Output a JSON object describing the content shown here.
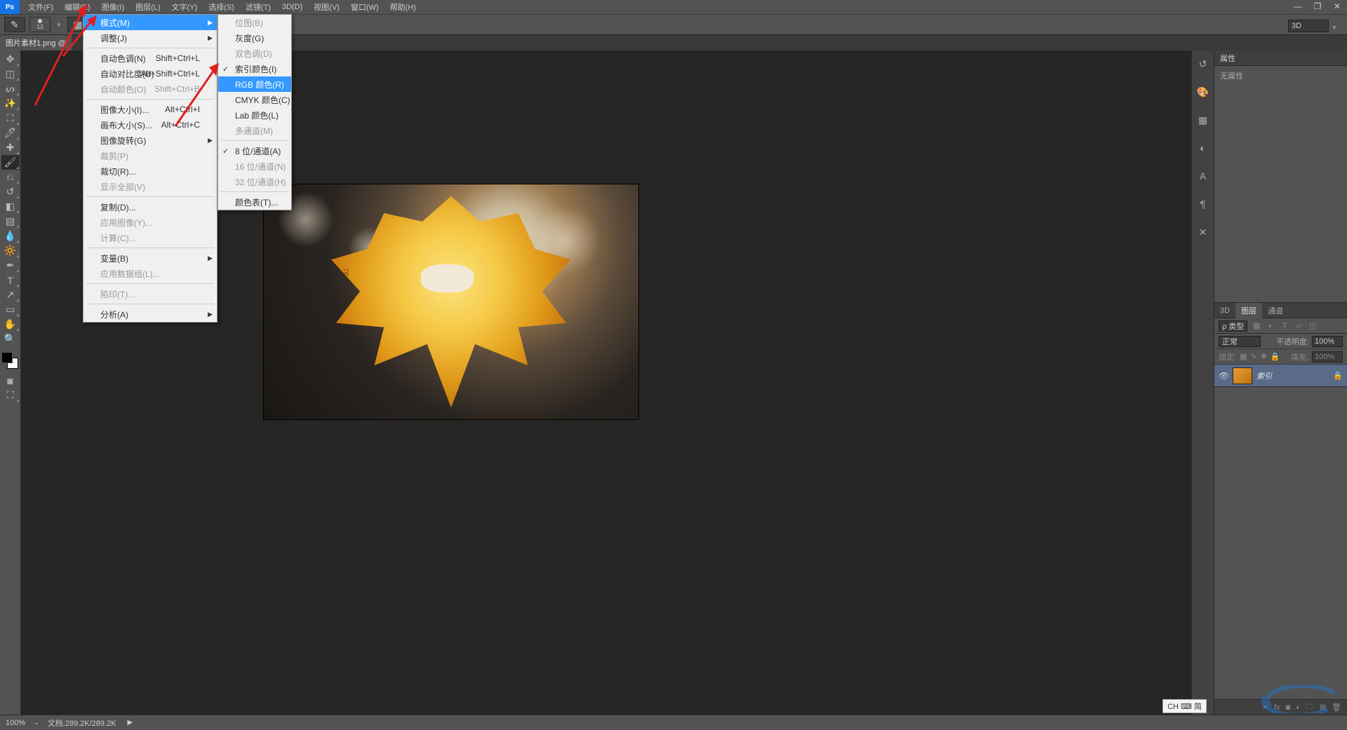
{
  "menu": {
    "items": [
      "文件(F)",
      "编辑(E)",
      "图像(I)",
      "图层(L)",
      "文字(Y)",
      "选择(S)",
      "滤镜(T)",
      "3D(D)",
      "视图(V)",
      "窗口(W)",
      "帮助(H)"
    ]
  },
  "opt": {
    "brush_size": "13",
    "mode": "模式",
    "zoom": "100%"
  },
  "tab3d": "3D",
  "doctab": "图片素材1.png @",
  "dropdown1": {
    "mode": "模式(M)",
    "adjust": "调整(J)",
    "auto_tone": "自动色调(N)",
    "auto_tone_sc": "Shift+Ctrl+L",
    "auto_contrast": "自动对比度(U)",
    "auto_contrast_sc": "Alt+Shift+Ctrl+L",
    "auto_color": "自动颜色(O)",
    "auto_color_sc": "Shift+Ctrl+B",
    "img_size": "图像大小(I)...",
    "img_size_sc": "Alt+Ctrl+I",
    "canvas_size": "画布大小(S)...",
    "canvas_size_sc": "Alt+Ctrl+C",
    "rotate": "图像旋转(G)",
    "crop": "裁剪(P)",
    "trim": "裁切(R)...",
    "reveal": "显示全部(V)",
    "duplicate": "复制(D)...",
    "apply": "应用图像(Y)...",
    "calc": "计算(C)...",
    "vars": "变量(B)",
    "datasets": "应用数据组(L)...",
    "trap": "陷印(T)...",
    "analysis": "分析(A)"
  },
  "dropdown2": {
    "bitmap": "位图(B)",
    "gray": "灰度(G)",
    "duo": "双色调(D)",
    "indexed": "索引颜色(I)",
    "rgb": "RGB 颜色(R)",
    "cmyk": "CMYK 颜色(C)",
    "lab": "Lab 颜色(L)",
    "multi": "多通道(M)",
    "b8": "8 位/通道(A)",
    "b16": "16 位/通道(N)",
    "b32": "32 位/通道(H)",
    "ctable": "颜色表(T)..."
  },
  "props": {
    "title": "属性",
    "none": "无属性"
  },
  "layers": {
    "tab_3d": "3D",
    "tab_layers": "图层",
    "tab_channels": "通道",
    "kind": "ρ 类型",
    "blend": "正常",
    "opacity_lbl": "不透明度:",
    "opacity": "100%",
    "lock_lbl": "锁定:",
    "fill_lbl": "填充:",
    "fill": "100%",
    "layer_name": "索引"
  },
  "status": {
    "zoom": "100%",
    "doc": "文档:289.2K/289.2K"
  },
  "ime": "CH ⌨ 简"
}
